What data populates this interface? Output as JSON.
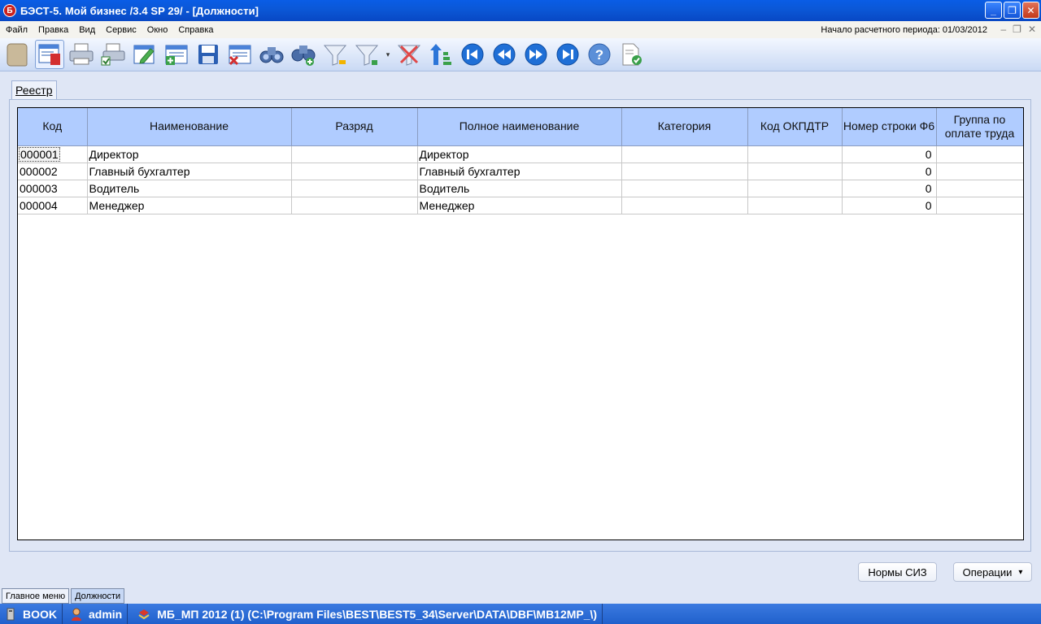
{
  "window": {
    "title": "БЭСТ-5. Мой бизнес /3.4 SP 29/ - [Должности]",
    "app_icon": "Б",
    "controls": {
      "minimize": "_",
      "maximize": "❐",
      "close": "✕"
    }
  },
  "menu": {
    "items": [
      "Файл",
      "Правка",
      "Вид",
      "Сервис",
      "Окно",
      "Справка"
    ],
    "period": "Начало расчетного периода: 01/03/2012",
    "mdi_controls": {
      "minimize": "‒",
      "restore": "❐",
      "close": "✕"
    }
  },
  "toolbar": {
    "icons": [
      "book-icon",
      "registry-icon",
      "print-icon",
      "print-preview-icon",
      "edit-icon",
      "add-record-icon",
      "save-icon",
      "delete-record-icon",
      "find-icon",
      "find-next-icon",
      "filter-icon",
      "filter-dropdown-icon",
      "clear-filter-icon",
      "sort-icon",
      "first-record-icon",
      "previous-record-icon",
      "next-record-icon",
      "last-record-icon",
      "help-icon",
      "export-icon"
    ]
  },
  "tab": {
    "label": "Реестр"
  },
  "table": {
    "columns": [
      "Код",
      "Наименование",
      "Разряд",
      "Полное наименование",
      "Категория",
      "Код ОКПДТР",
      "Номер строки Ф6",
      "Группа по оплате труда"
    ],
    "rows": [
      [
        "000001",
        "Директор",
        "",
        "Директор",
        "",
        "",
        "0",
        ""
      ],
      [
        "000002",
        "Главный бухгалтер",
        "",
        "Главный бухгалтер",
        "",
        "",
        "0",
        ""
      ],
      [
        "000003",
        "Водитель",
        "",
        "Водитель",
        "",
        "",
        "0",
        ""
      ],
      [
        "000004",
        "Менеджер",
        "",
        "Менеджер",
        "",
        "",
        "0",
        ""
      ]
    ]
  },
  "buttons": {
    "siz_norms": "Нормы СИЗ",
    "operations": "Операции",
    "operations_arrow": "▾"
  },
  "mdi_tabs": [
    "Главное меню",
    "Должности"
  ],
  "status": {
    "computer": "BOOK",
    "user": "admin",
    "database": "МБ_МП 2012 (1) (C:\\Program Files\\BEST\\BEST5_34\\Server\\DATA\\DBF\\MB12MP_\\)"
  },
  "colors": {
    "header_bg": "#b0ccff",
    "titlebar": "#0b58d8",
    "statusbar": "#2c6ad4"
  }
}
